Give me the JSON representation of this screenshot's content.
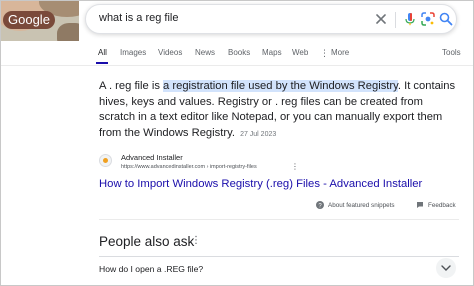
{
  "search": {
    "logo_text": "Google",
    "query": "what is a reg file"
  },
  "tabs": [
    {
      "label": "All",
      "active": true
    },
    {
      "label": "Images"
    },
    {
      "label": "Videos"
    },
    {
      "label": "News"
    },
    {
      "label": "Books"
    },
    {
      "label": "Maps"
    },
    {
      "label": "Web"
    },
    {
      "label": "More"
    }
  ],
  "tools_label": "Tools",
  "snippet": {
    "text_before": "A . reg file is ",
    "highlight": "a registration file used by the Windows Registry",
    "text_after": ". It contains hives, keys and values. Registry or . reg files can be created from scratch in a text editor like Notepad, or you can manually export them from the Windows Registry.",
    "date": "27 Jul 2023"
  },
  "source": {
    "site_name": "Advanced Installer",
    "url": "https://www.advancedinstaller.com › import-registry-files",
    "title": "How to Import Windows Registry (.reg) Files - Advanced Installer"
  },
  "footer": {
    "about_label": "About featured snippets",
    "feedback_label": "Feedback"
  },
  "people_also_ask": {
    "title": "People also ask",
    "questions": [
      "How do I open a .REG file?"
    ]
  },
  "colors": {
    "link": "#1a0dab",
    "highlight": "#d2e3fc",
    "text": "#202124"
  }
}
